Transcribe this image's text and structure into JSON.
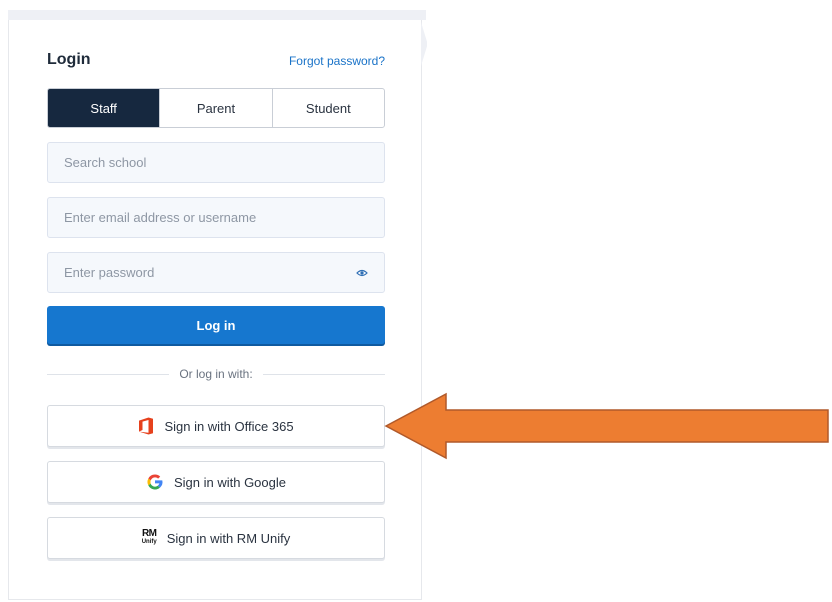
{
  "login": {
    "title": "Login",
    "forgot_password": "Forgot password?",
    "tabs": [
      {
        "label": "Staff",
        "active": true
      },
      {
        "label": "Parent",
        "active": false
      },
      {
        "label": "Student",
        "active": false
      }
    ],
    "fields": {
      "school_placeholder": "Search school",
      "email_placeholder": "Enter email address or username",
      "password_placeholder": "Enter password"
    },
    "login_button": "Log in",
    "divider_text": "Or log in with:",
    "sso": {
      "office365": "Sign in with Office 365",
      "google": "Sign in with Google",
      "rm_unify": "Sign in with RM Unify",
      "rm_logo_top": "RM",
      "rm_logo_bottom": "Unify"
    }
  },
  "colors": {
    "active_tab": "#16283f",
    "primary": "#1677cf",
    "link": "#1a73c8",
    "arrow": "#ed7d31",
    "arrow_stroke": "#b0592a",
    "office": "#e6411d"
  },
  "icons": {
    "password_toggle": "eye-icon",
    "office365": "office365-icon",
    "google": "google-icon",
    "rm_unify": "rm-unify-logo",
    "annotation": "left-arrow-icon"
  }
}
